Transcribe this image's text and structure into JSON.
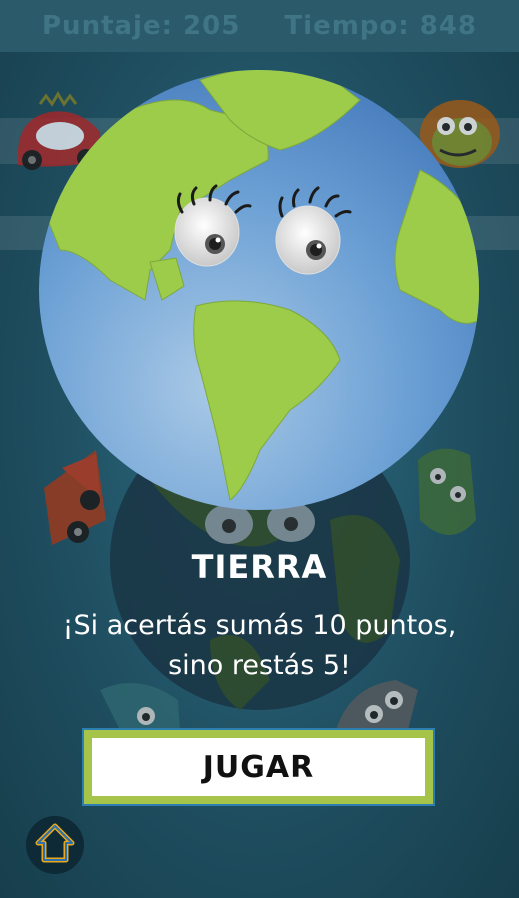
{
  "hud": {
    "score_label": "Puntaje: 205",
    "time_label": "Tiempo: 848"
  },
  "card": {
    "planet_name": "TIERRA",
    "message_line1": "¡Si acertás sumás 10 puntos,",
    "message_line2": "sino restás 5!",
    "play_label": "JUGAR"
  },
  "icons": {
    "home": "home-arrow-icon"
  },
  "colors": {
    "ocean": "#6a9fd4",
    "land": "#9ccc4a",
    "button_border": "#a6c44a"
  }
}
